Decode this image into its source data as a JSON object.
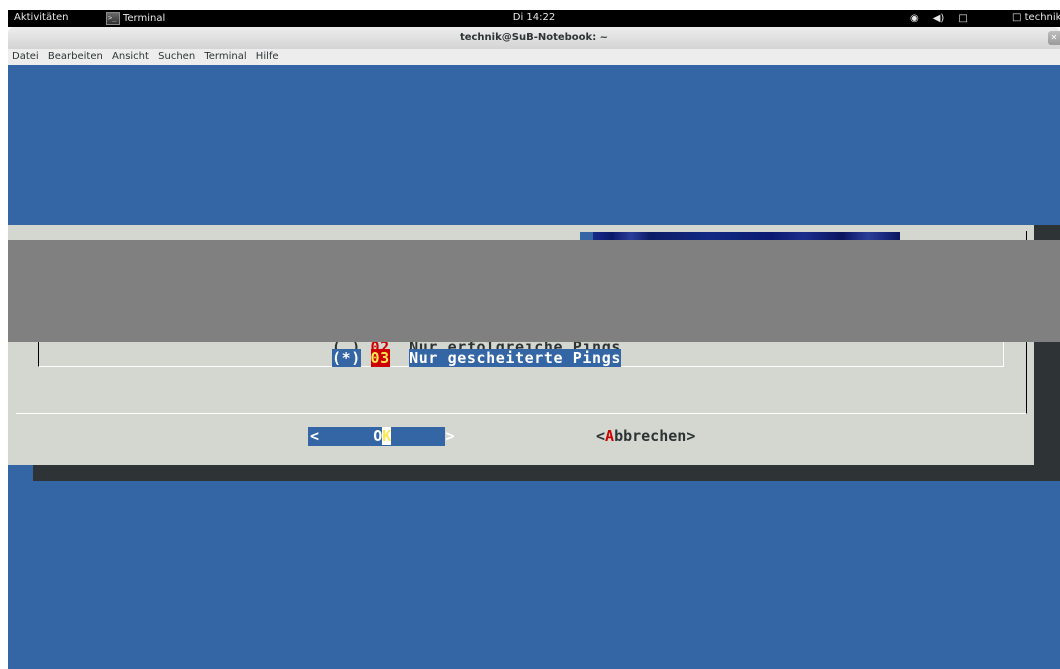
{
  "topbar": {
    "activities": "Aktivitäten",
    "app_name": "Terminal",
    "clock": "Di 14:22",
    "user": "technik",
    "tray_icons": [
      "accessibility-icon",
      "volume-icon",
      "network-icon",
      "user-icon"
    ]
  },
  "window": {
    "title": "technik@SuB-Notebook: ~"
  },
  "menu": [
    "Datei",
    "Bearbeiten",
    "Ansicht",
    "Suchen",
    "Terminal",
    "Hilfe"
  ],
  "dialog": {
    "items": [
      {
        "marker": "( )",
        "tag": "02",
        "label": "Nur erfolgreiche Pings",
        "selected": false
      },
      {
        "marker": "(*)",
        "tag": "03",
        "label": "Nur gescheiterte Pings",
        "selected": true
      }
    ],
    "ok_button": {
      "left": "<",
      "hot": "O",
      "rest": "K",
      "right": ">"
    },
    "cancel_button": {
      "open": "<",
      "hot": "A",
      "rest": "bbrechen",
      "close": ">"
    }
  },
  "colors": {
    "terminal_bg": "#3465a4",
    "dialog_bg": "#d3d7cf",
    "highlight_red": "#cc0000",
    "highlight_yellow": "#fce94f",
    "overlay": "#808080"
  }
}
